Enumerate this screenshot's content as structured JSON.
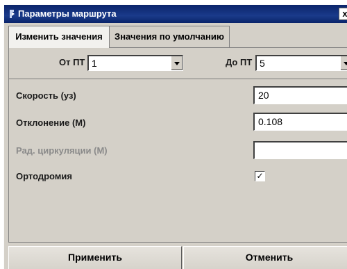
{
  "window": {
    "title": "Параметры маршрута",
    "close_label": "x"
  },
  "tabs": [
    {
      "label": "Изменить значения",
      "active": true
    },
    {
      "label": "Значения по умолчанию",
      "active": false
    }
  ],
  "range": {
    "from_label": "От ПТ",
    "from_value": "1",
    "to_label": "До ПТ",
    "to_value": "5"
  },
  "fields": {
    "speed_label": "Скорость (уз)",
    "speed_value": "20",
    "deviation_label": "Отклонение (М)",
    "deviation_value": "0.108",
    "circ_radius_label": "Рад. циркуляции (М)",
    "circ_radius_value": "",
    "orthodromy_label": "Ортодромия",
    "orthodromy_checked": true,
    "check_mark": "✓"
  },
  "buttons": {
    "apply_label": "Применить",
    "cancel_label": "Отменить"
  },
  "colors": {
    "title_bar": "#0a246a",
    "face": "#d4d0c8",
    "disabled_text": "#8a8a8a"
  }
}
